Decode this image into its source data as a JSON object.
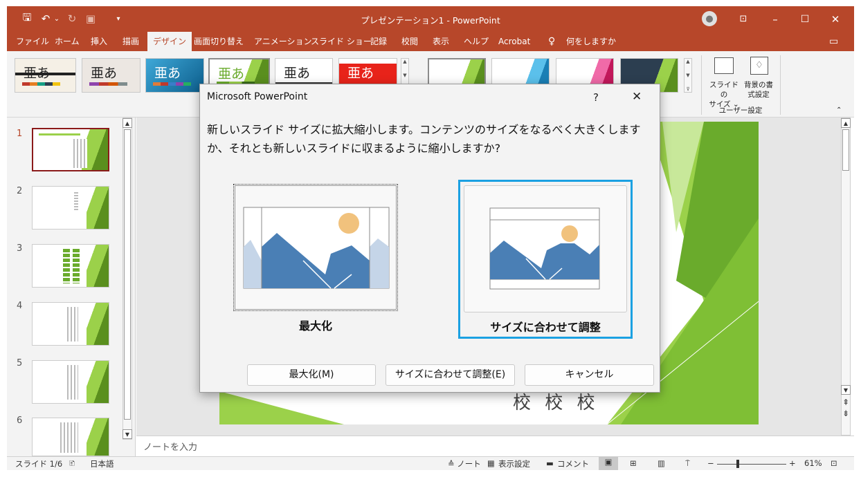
{
  "window": {
    "title": "プレゼンテーション1 - PowerPoint",
    "minimize": "–",
    "maximize": "☐",
    "close": "✕"
  },
  "qat": {
    "save": "🖫",
    "undo": "↶",
    "undo_menu": "⌄",
    "redo": "↻",
    "more": "▾"
  },
  "tabs": [
    {
      "label": "ファイル",
      "active": false
    },
    {
      "label": "ホーム",
      "active": false
    },
    {
      "label": "挿入",
      "active": false
    },
    {
      "label": "描画",
      "active": false
    },
    {
      "label": "デザイン",
      "active": true
    },
    {
      "label": "画面切り替え",
      "active": false
    },
    {
      "label": "アニメーション",
      "active": false
    },
    {
      "label": "スライド ショー",
      "active": false
    },
    {
      "label": "記録",
      "active": false
    },
    {
      "label": "校閲",
      "active": false
    },
    {
      "label": "表示",
      "active": false
    },
    {
      "label": "ヘルプ",
      "active": false
    },
    {
      "label": "Acrobat",
      "active": false
    }
  ],
  "tellme": "何をしますか",
  "ribbon": {
    "themes": [
      {
        "glyph": "亜あ"
      },
      {
        "glyph": "亜あ"
      },
      {
        "glyph": "亜あ"
      },
      {
        "glyph": "亜あ"
      },
      {
        "glyph": "亜あ"
      },
      {
        "glyph": "亜あ"
      }
    ],
    "slide_size_label": "スライドの\nサイズ ⌄",
    "bg_format_label": "背景の書\n式設定",
    "group_label": "ユーザー設定",
    "collapse": "⌃"
  },
  "slides": [
    {
      "num": "1",
      "selected": true
    },
    {
      "num": "2"
    },
    {
      "num": "3"
    },
    {
      "num": "4"
    },
    {
      "num": "5"
    },
    {
      "num": "6"
    }
  ],
  "slide_canvas": {
    "text": "校 校 校"
  },
  "notes_placeholder": "ノートを入力",
  "status": {
    "slide": "スライド 1/6",
    "language": "日本語",
    "notes": "≙ ノート",
    "display_settings": "表示設定",
    "comments": "コメント",
    "zoom_minus": "−",
    "zoom_plus": "+",
    "zoom": "61%"
  },
  "dialog": {
    "title": "Microsoft PowerPoint",
    "help": "?",
    "close": "✕",
    "message": "新しいスライド サイズに拡大縮小します。コンテンツのサイズをなるべく大きくしますか、それとも新しいスライドに収まるように縮小しますか?",
    "option_maximize": "最大化",
    "option_fit": "サイズに合わせて調整",
    "btn_maximize": "最大化(M)",
    "btn_fit": "サイズに合わせて調整(E)",
    "btn_cancel": "キャンセル"
  }
}
